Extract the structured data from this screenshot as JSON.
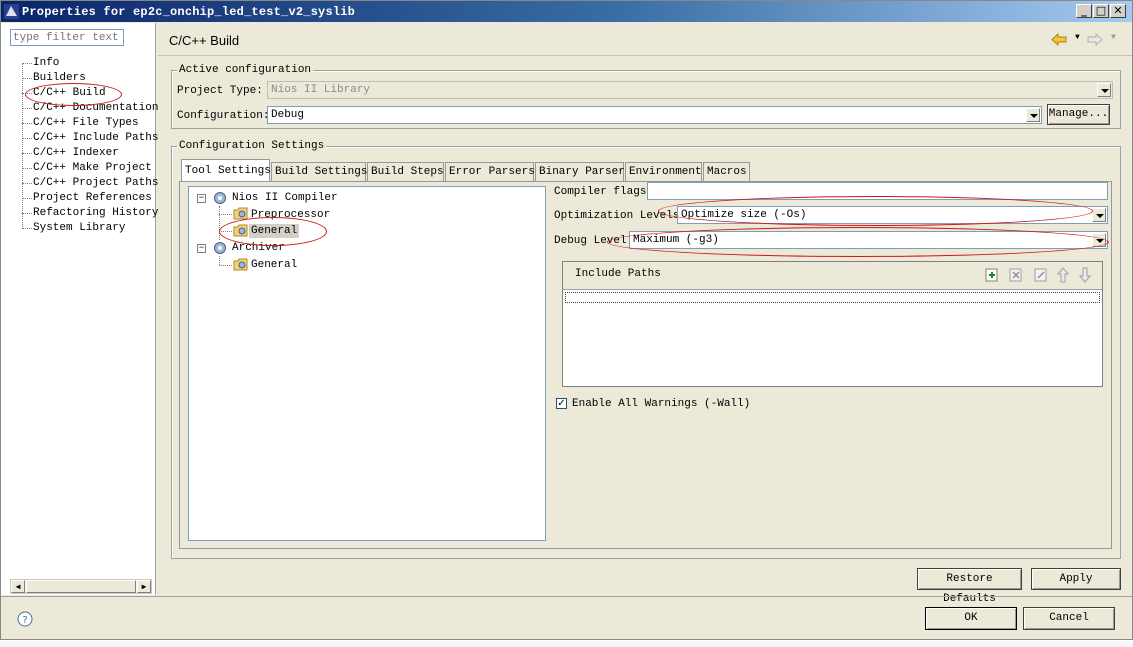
{
  "window": {
    "title": "Properties for ep2c_onchip_led_test_v2_syslib"
  },
  "sidebar": {
    "filter_placeholder": "type filter text",
    "items": [
      {
        "label": "Info"
      },
      {
        "label": "Builders"
      },
      {
        "label": "C/C++ Build"
      },
      {
        "label": "C/C++ Documentation"
      },
      {
        "label": "C/C++ File Types"
      },
      {
        "label": "C/C++ Include Paths"
      },
      {
        "label": "C/C++ Indexer"
      },
      {
        "label": "C/C++ Make Project"
      },
      {
        "label": "C/C++ Project Paths"
      },
      {
        "label": "Project References"
      },
      {
        "label": "Refactoring History"
      },
      {
        "label": "System Library"
      }
    ]
  },
  "page": {
    "title": "C/C++ Build"
  },
  "active_config": {
    "group_label": "Active configuration",
    "project_type_label": "Project Type:",
    "project_type_value": "Nios II Library",
    "configuration_label": "Configuration:",
    "configuration_value": "Debug",
    "manage_button": "Manage..."
  },
  "config_settings": {
    "group_label": "Configuration Settings",
    "tabs": [
      {
        "label": "Tool Settings"
      },
      {
        "label": "Build Settings"
      },
      {
        "label": "Build Steps"
      },
      {
        "label": "Error Parsers"
      },
      {
        "label": "Binary Parser"
      },
      {
        "label": "Environment"
      },
      {
        "label": "Macros"
      }
    ],
    "tree": {
      "compiler": "Nios II Compiler",
      "preprocessor": "Preprocessor",
      "general": "General",
      "archiver": "Archiver",
      "archiver_general": "General"
    },
    "compiler_flags_label": "Compiler flags",
    "compiler_flags_value": "",
    "optimization_label": "Optimization Levels",
    "optimization_value": "Optimize size (-Os)",
    "debug_label": "Debug Level",
    "debug_value": "Maximum (-g3)",
    "include_paths_label": "Include Paths",
    "enable_warnings_label": "Enable All Warnings (-Wall)",
    "enable_warnings_checked": true
  },
  "buttons": {
    "restore_defaults": "Restore Defaults",
    "apply": "Apply",
    "ok": "OK",
    "cancel": "Cancel"
  },
  "colors": {
    "annotation": "#cc1a1a",
    "title_bar": "#0a246a"
  }
}
